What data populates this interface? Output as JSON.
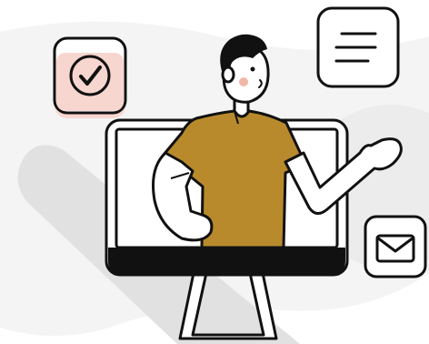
{
  "illustration": {
    "icons": [
      "check-icon",
      "menu-icon",
      "mail-icon"
    ],
    "colors": {
      "background_blob": "#f4f4f4",
      "shadow": "#e3e3e3",
      "shirt": "#b88a2c",
      "check_tint": "#f7d6cf",
      "blush": "#f2b7a6",
      "outline": "#111111",
      "skin": "#ffffff"
    }
  }
}
